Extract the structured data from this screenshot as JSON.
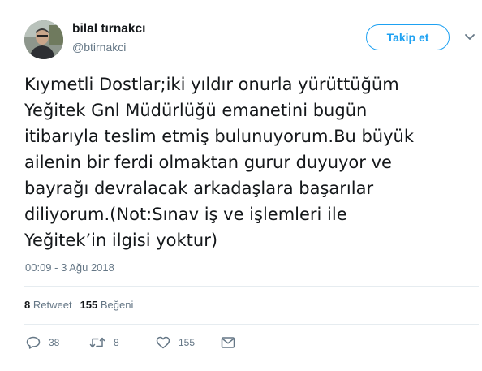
{
  "user": {
    "name": "bilal tırnakcı",
    "handle": "@btirnakci"
  },
  "follow_button": {
    "label": "Takip et"
  },
  "tweet": {
    "lines": [
      "Kıymetli Dostlar;iki yıldır onurla yürüttüğüm",
      "Yeğitek Gnl Müdürlüğü emanetini bugün",
      "itibarıyla teslim etmiş bulunuyorum.Bu büyük",
      "ailenin bir ferdi olmaktan gurur duyuyor ve",
      "bayrağı devralacak arkadaşlara başarılar",
      "diliyorum.(Not:Sınav iş ve işlemleri ile",
      "Yeğitek’in ilgisi yoktur)"
    ],
    "timestamp": "00:09 - 3 Ağu 2018"
  },
  "stats": {
    "retweet_count": "8",
    "retweet_label": "Retweet",
    "like_count": "155",
    "like_label": "Beğeni"
  },
  "actions": {
    "reply_count": "38",
    "retweet_count": "8",
    "like_count": "155"
  },
  "icons": {
    "reply": "reply-icon",
    "retweet": "retweet-icon",
    "like": "heart-icon",
    "dm": "direct-message-icon",
    "caret": "chevron-down-icon"
  },
  "colors": {
    "accent": "#1da1f2",
    "text": "#14171a",
    "muted": "#657786",
    "divider": "#e6ecf0"
  }
}
